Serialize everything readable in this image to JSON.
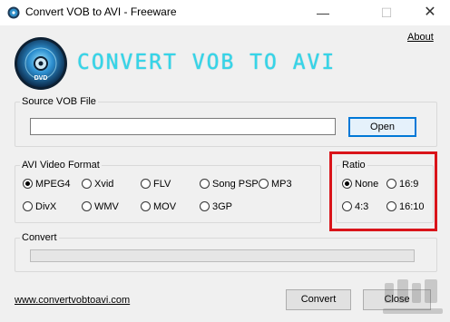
{
  "window": {
    "title": "Convert VOB to AVI - Freeware",
    "minimize_glyph": "—",
    "maximize_glyph": "☐",
    "close_glyph": "✕"
  },
  "header": {
    "about_label": "About",
    "logo_text": "CONVERT VOB TO AVI",
    "disc_label": "DVD"
  },
  "source": {
    "group_label": "Source VOB File",
    "file_value": "",
    "open_label": "Open"
  },
  "format": {
    "group_label": "AVI Video Format",
    "options": [
      "MPEG4",
      "Xvid",
      "FLV",
      "Song PSP",
      "MP3",
      "DivX",
      "WMV",
      "MOV",
      "3GP"
    ],
    "selected": "MPEG4"
  },
  "ratio": {
    "group_label": "Ratio",
    "options": [
      "None",
      "16:9",
      "4:3",
      "16:10"
    ],
    "selected": "None"
  },
  "convert": {
    "group_label": "Convert",
    "progress": 0
  },
  "footer": {
    "website": "www.convertvobtoavi.com",
    "convert_label": "Convert",
    "close_label": "Close"
  },
  "icons": {
    "app": "disc-icon",
    "logo": "dvd-disc-icon"
  },
  "colors": {
    "logo_text": "#35d5e8",
    "highlight": "#d9141a",
    "accent": "#0078d7"
  }
}
